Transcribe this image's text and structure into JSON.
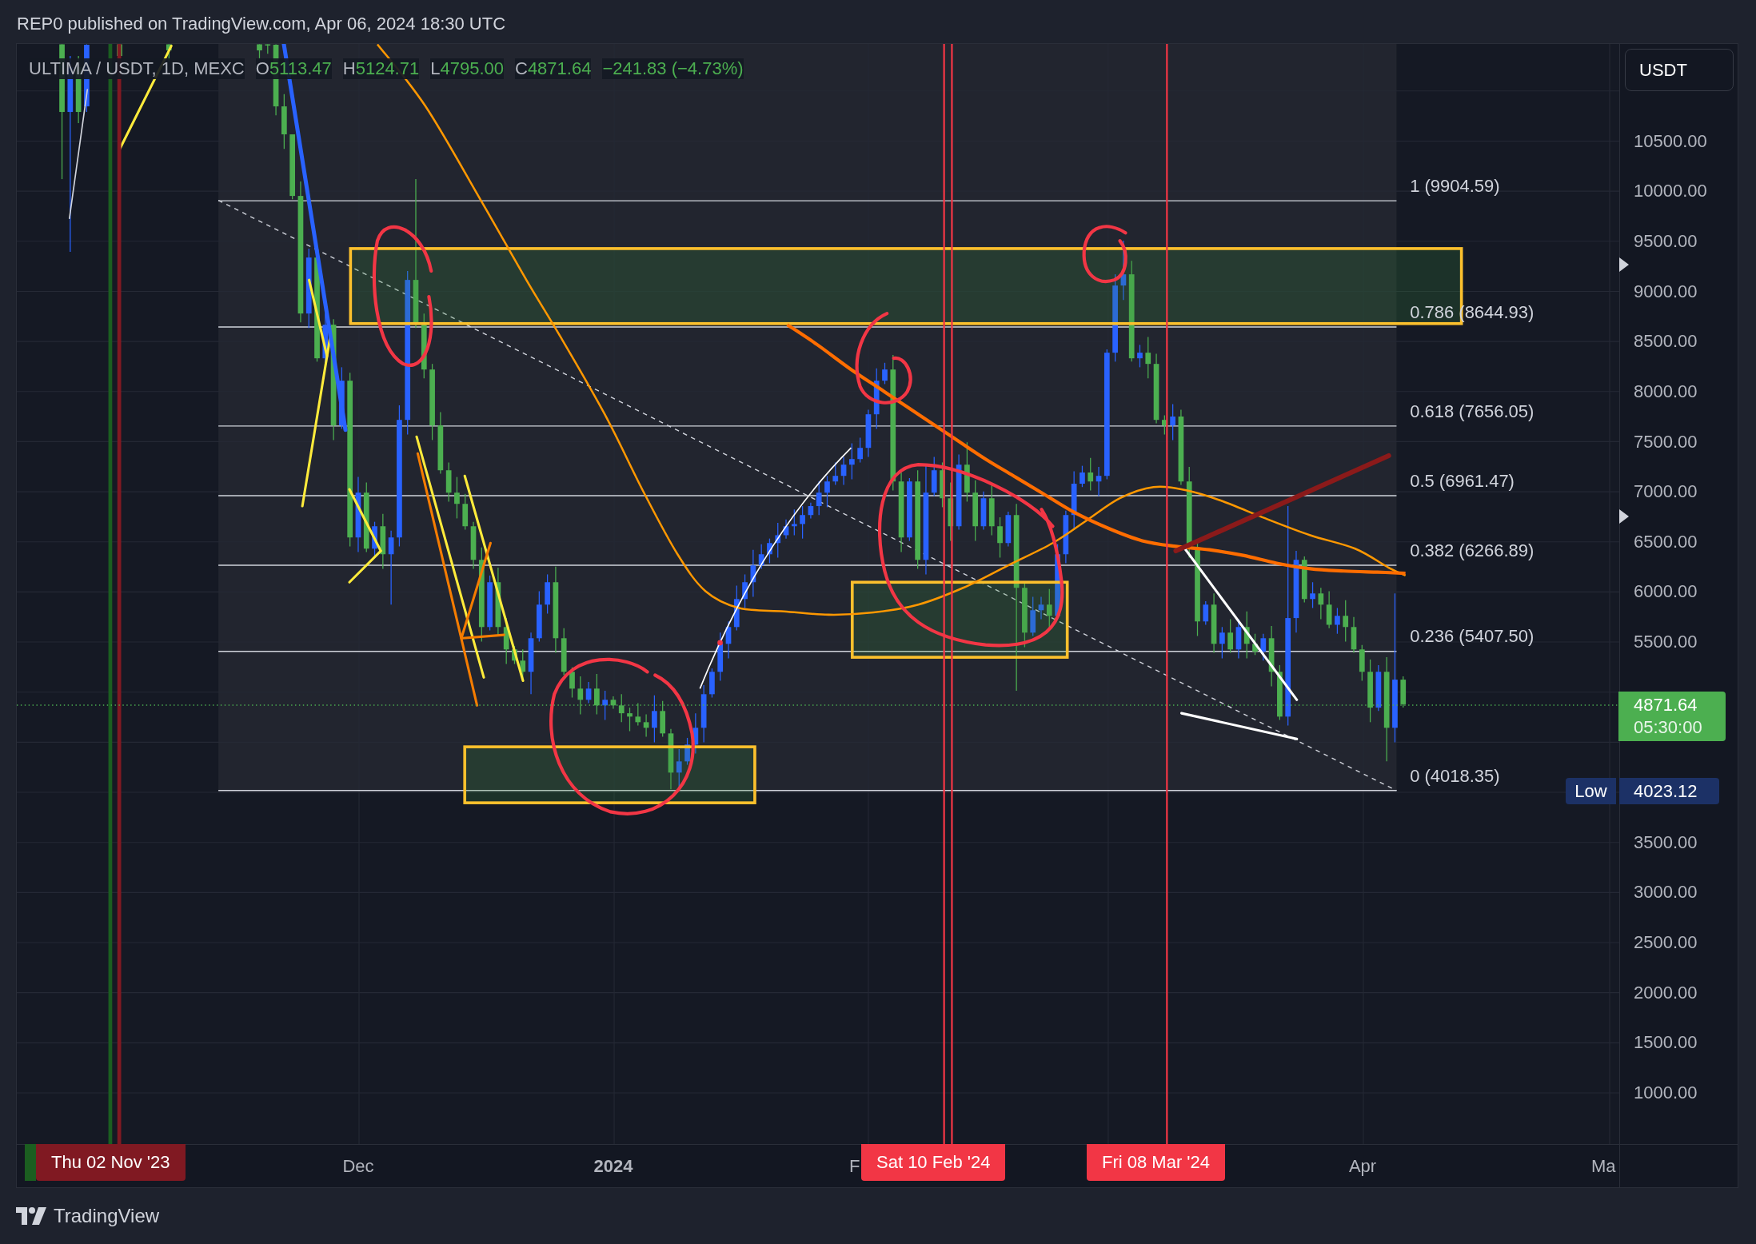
{
  "header": {
    "text": "REP0 published on TradingView.com, Apr 06, 2024 18:30 UTC"
  },
  "legend": {
    "symbol": "ULTIMA / USDT, 1D, MEXC",
    "ohlc": [
      {
        "label": "O",
        "value": "5113.47"
      },
      {
        "label": "H",
        "value": "5124.71"
      },
      {
        "label": "L",
        "value": "4795.00"
      },
      {
        "label": "C",
        "value": "4871.64"
      }
    ],
    "change": "−241.83 (−4.73%)"
  },
  "fib_levels": [
    {
      "label": "1 (9904.59)"
    },
    {
      "label": "0.786 (8644.93)"
    },
    {
      "label": "0.618 (7656.05)"
    },
    {
      "label": "0.5 (6961.47)"
    },
    {
      "label": "0.382 (6266.89)"
    },
    {
      "label": "0.236 (5407.50)"
    },
    {
      "label": "0 (4018.35)"
    }
  ],
  "price_axis": {
    "currency": "USDT",
    "ticks": [
      "10500.00",
      "10000.00",
      "9500.00",
      "9000.00",
      "8500.00",
      "8000.00",
      "7500.00",
      "7000.00",
      "6500.00",
      "6000.00",
      "5500.00",
      "3500.00",
      "3000.00",
      "2500.00",
      "2000.00",
      "1500.00",
      "1000.00"
    ],
    "last_price": {
      "price": "4871.64",
      "countdown": "05:30:00"
    },
    "low": {
      "label": "Low",
      "price": "4023.12"
    }
  },
  "time_axis": [
    {
      "text": "Thu 02 Nov '23",
      "kind": "marker",
      "color": "#801922"
    },
    {
      "text": "Dec",
      "kind": "month"
    },
    {
      "text": "2024",
      "kind": "year"
    },
    {
      "text": "F",
      "kind": "month"
    },
    {
      "text": "Sat 10 Feb '24",
      "kind": "marker",
      "color": "#f23645"
    },
    {
      "text": "Fri 08 Mar '24",
      "kind": "marker",
      "color": "#f23645"
    },
    {
      "text": "Apr",
      "kind": "month"
    },
    {
      "text": "Ma",
      "kind": "month"
    }
  ],
  "footer": {
    "brand": "TradingView"
  }
}
